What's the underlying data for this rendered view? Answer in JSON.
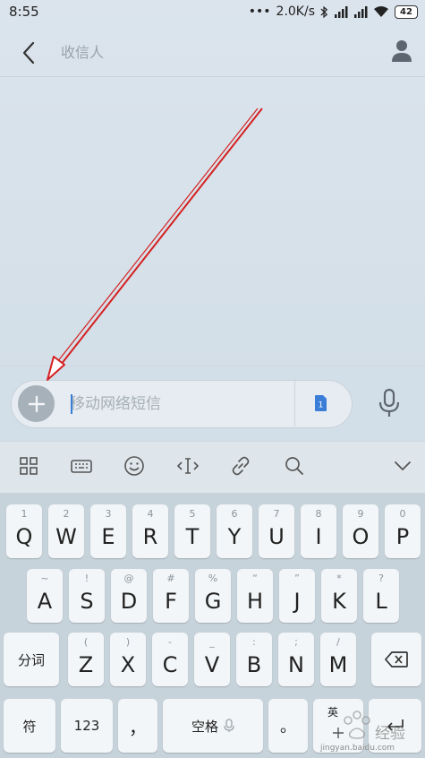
{
  "status_bar": {
    "time": "8:55",
    "network_speed": "2.0K/s",
    "battery": "42",
    "dots": "•••"
  },
  "header": {
    "recipient_placeholder": "收信人"
  },
  "compose": {
    "placeholder": "移动网络短信",
    "sim_label": "1"
  },
  "keyboard": {
    "row1": [
      {
        "main": "Q",
        "sub": "1"
      },
      {
        "main": "W",
        "sub": "2"
      },
      {
        "main": "E",
        "sub": "3"
      },
      {
        "main": "R",
        "sub": "4"
      },
      {
        "main": "T",
        "sub": "5"
      },
      {
        "main": "Y",
        "sub": "6"
      },
      {
        "main": "U",
        "sub": "7"
      },
      {
        "main": "I",
        "sub": "8"
      },
      {
        "main": "O",
        "sub": "9"
      },
      {
        "main": "P",
        "sub": "0"
      }
    ],
    "row2": [
      {
        "main": "A",
        "sub": "~"
      },
      {
        "main": "S",
        "sub": "!"
      },
      {
        "main": "D",
        "sub": "@"
      },
      {
        "main": "F",
        "sub": "#"
      },
      {
        "main": "G",
        "sub": "%"
      },
      {
        "main": "H",
        "sub": "“"
      },
      {
        "main": "J",
        "sub": "”"
      },
      {
        "main": "K",
        "sub": "*"
      },
      {
        "main": "L",
        "sub": "?"
      }
    ],
    "row3": [
      {
        "main": "Z",
        "sub": "("
      },
      {
        "main": "X",
        "sub": ")"
      },
      {
        "main": "C",
        "sub": "-"
      },
      {
        "main": "V",
        "sub": "_"
      },
      {
        "main": "B",
        "sub": ":"
      },
      {
        "main": "N",
        "sub": ";"
      },
      {
        "main": "M",
        "sub": "/"
      }
    ],
    "split_word": "分词",
    "symbol": "符",
    "numbers": "123",
    "comma": "，",
    "space": "空格",
    "period": "。",
    "lang": "英"
  },
  "watermark": {
    "text": "jingyan.baidu.com",
    "brand": "经验"
  }
}
